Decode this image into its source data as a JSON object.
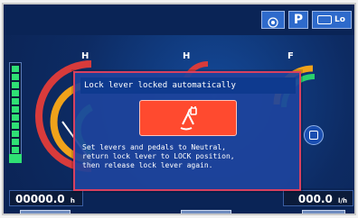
{
  "topbar": {
    "buttons": [
      {
        "name": "settings",
        "label": "",
        "icon": "settings-icon"
      },
      {
        "name": "parking",
        "label": "P",
        "icon": ""
      },
      {
        "name": "lo",
        "label": "Lo",
        "icon": "lo-mode-icon"
      }
    ]
  },
  "gauges": [
    {
      "label": "H"
    },
    {
      "label": "H"
    },
    {
      "label": "F"
    }
  ],
  "popup": {
    "title": "Lock lever locked automatically",
    "message": "Set levers and pedals to Neutral,\nreturn lock lever to LOCK position,\nthen release lock lever again.",
    "icon": "lock-lever-icon",
    "icon_color": "#ff4a2f"
  },
  "bottom": {
    "left_readout": {
      "value": "00000.0",
      "unit": "h"
    },
    "right_readout": {
      "value": "000.0",
      "unit": "l/h"
    }
  },
  "softkeys": [
    {
      "name": "softkey-1",
      "label": ""
    },
    {
      "name": "softkey-2",
      "label": ""
    },
    {
      "name": "softkey-3",
      "label": ""
    }
  ],
  "colors": {
    "background": "#0d2b63",
    "popup_border": "#d84060",
    "popup_fill": "#1d439c",
    "alarm": "#ff4a2f"
  }
}
